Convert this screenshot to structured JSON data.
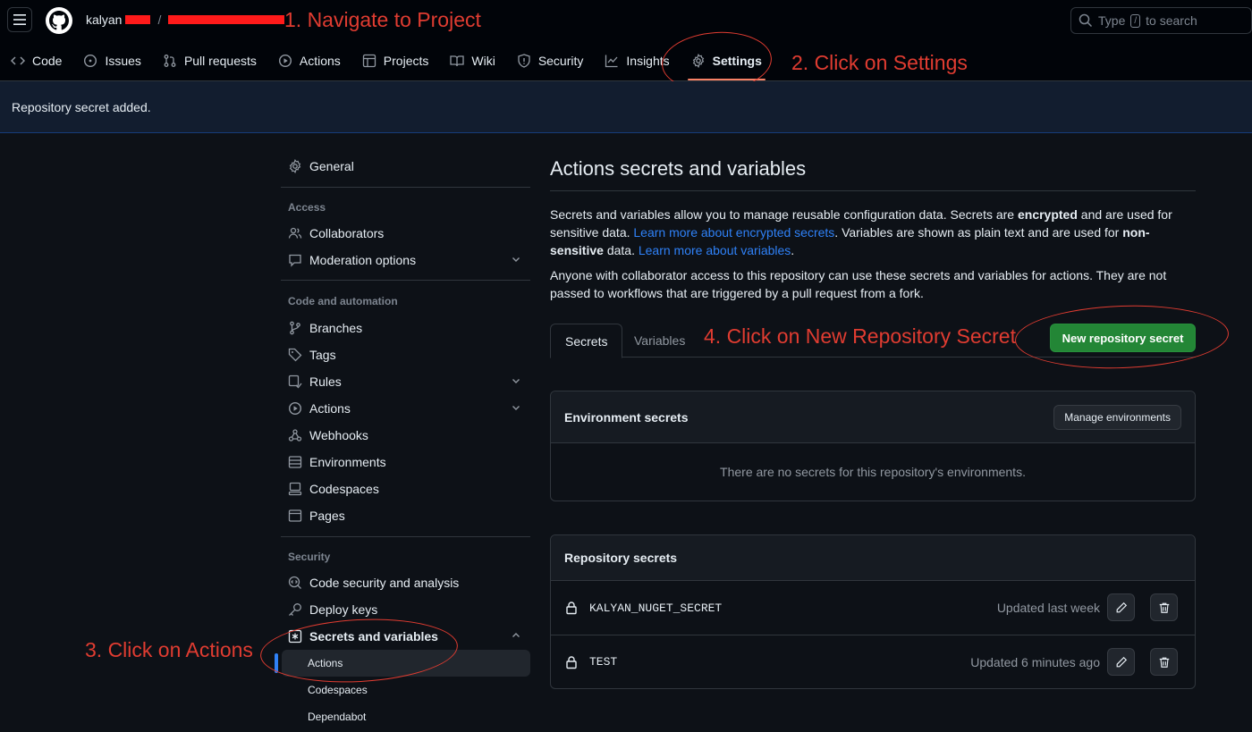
{
  "header": {
    "repo_owner": "kalyan",
    "repo_separator": "/",
    "search_placeholder_pre": "Type",
    "search_key": "/",
    "search_placeholder_post": "to search"
  },
  "annotations": {
    "step1": "1. Navigate to Project",
    "step2": "2. Click on Settings",
    "step3": "3. Click on Actions",
    "step4": "4. Click on New Repository Secret",
    "color": "#e03c31"
  },
  "repo_tabs": [
    {
      "label": "Code",
      "icon": "code-icon"
    },
    {
      "label": "Issues",
      "icon": "issue-icon"
    },
    {
      "label": "Pull requests",
      "icon": "pull-request-icon"
    },
    {
      "label": "Actions",
      "icon": "play-icon"
    },
    {
      "label": "Projects",
      "icon": "table-icon"
    },
    {
      "label": "Wiki",
      "icon": "book-icon"
    },
    {
      "label": "Security",
      "icon": "shield-icon"
    },
    {
      "label": "Insights",
      "icon": "graph-icon"
    },
    {
      "label": "Settings",
      "icon": "gear-icon",
      "active": true
    }
  ],
  "flash": {
    "message": "Repository secret added."
  },
  "sidebar": {
    "general": "General",
    "access_heading": "Access",
    "collaborators": "Collaborators",
    "moderation": "Moderation options",
    "code_heading": "Code and automation",
    "branches": "Branches",
    "tags": "Tags",
    "rules": "Rules",
    "actions": "Actions",
    "webhooks": "Webhooks",
    "environments": "Environments",
    "codespaces": "Codespaces",
    "pages": "Pages",
    "security_heading": "Security",
    "code_security": "Code security and analysis",
    "deploy_keys": "Deploy keys",
    "secrets_vars": "Secrets and variables",
    "sub_actions": "Actions",
    "sub_codespaces": "Codespaces",
    "sub_dependabot": "Dependabot"
  },
  "main": {
    "title": "Actions secrets and variables",
    "p1_a": "Secrets and variables allow you to manage reusable configuration data. Secrets are ",
    "p1_b": "encrypted",
    "p1_c": " and are used for sensitive data. ",
    "p1_link1": "Learn more about encrypted secrets",
    "p1_d": ". Variables are shown as plain text and are used for ",
    "p1_e": "non-sensitive",
    "p1_f": " data. ",
    "p1_link2": "Learn more about variables",
    "p1_g": ".",
    "p2": "Anyone with collaborator access to this repository can use these secrets and variables for actions. They are not passed to workflows that are triggered by a pull request from a fork.",
    "tab_secrets": "Secrets",
    "tab_variables": "Variables",
    "new_secret_button": "New repository secret",
    "env_heading": "Environment secrets",
    "manage_env_button": "Manage environments",
    "env_empty": "There are no secrets for this repository's environments.",
    "repo_heading": "Repository secrets",
    "secrets": [
      {
        "name": "KALYAN_NUGET_SECRET",
        "updated": "Updated last week"
      },
      {
        "name": "TEST",
        "updated": "Updated 6 minutes ago"
      }
    ]
  }
}
